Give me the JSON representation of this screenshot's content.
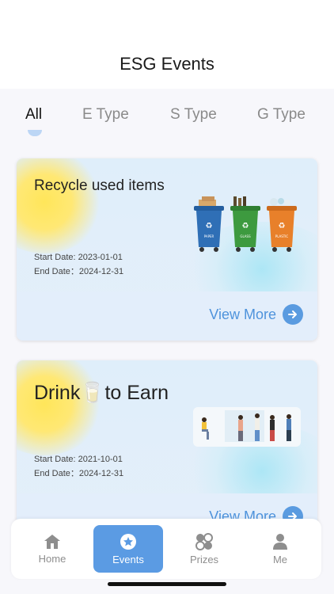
{
  "header": {
    "title": "ESG Events"
  },
  "tabs": [
    {
      "label": "All",
      "active": true
    },
    {
      "label": "E Type",
      "active": false
    },
    {
      "label": "S Type",
      "active": false
    },
    {
      "label": "G Type",
      "active": false
    }
  ],
  "events": [
    {
      "title": "Recycle used items",
      "start_date": "Start Date: 2023-01-01",
      "end_date": "End Date：2024-12-31",
      "view_more": "View More",
      "bin_labels": [
        "PAPER",
        "GLASS",
        "PLASTIC"
      ]
    },
    {
      "title": "Drink🥛to Earn",
      "start_date": "Start Date: 2021-10-01",
      "end_date": "End Date：2024-12-31",
      "view_more": "View More"
    }
  ],
  "nav": [
    {
      "label": "Home",
      "icon": "home-icon",
      "active": false
    },
    {
      "label": "Events",
      "icon": "star-icon",
      "active": true
    },
    {
      "label": "Prizes",
      "icon": "prizes-icon",
      "active": false
    },
    {
      "label": "Me",
      "icon": "person-icon",
      "active": false
    }
  ],
  "colors": {
    "accent": "#5b9be3",
    "link": "#4e93dc",
    "bin_blue": "#2f6fb6",
    "bin_green": "#3d9a3f",
    "bin_orange": "#e8802a"
  }
}
